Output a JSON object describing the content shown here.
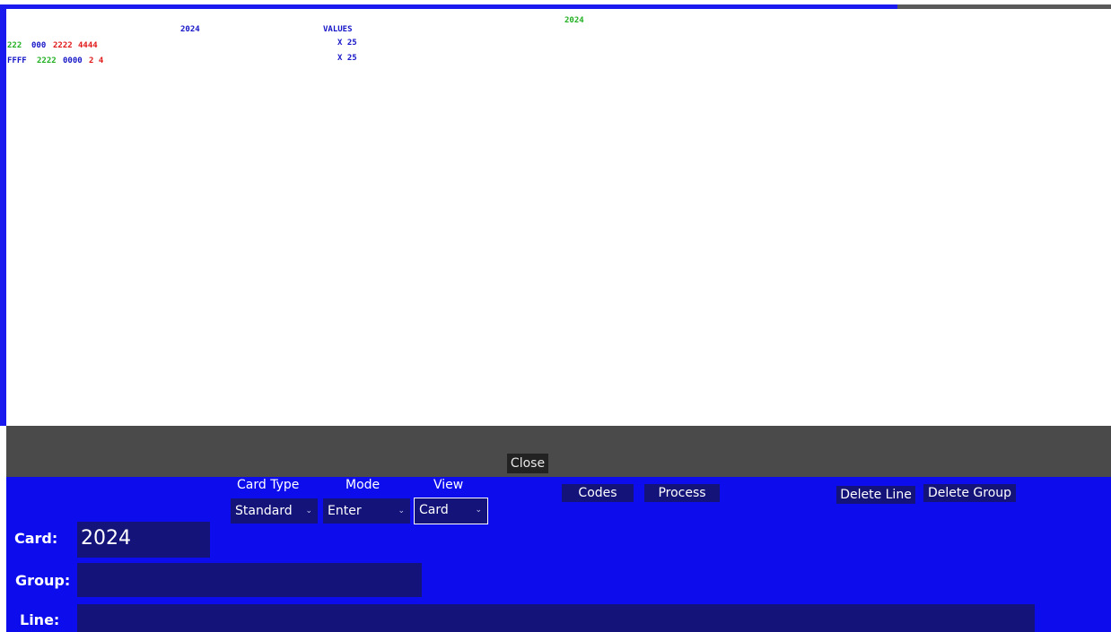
{
  "output": {
    "header_year": "2024",
    "header_values": "VALUES",
    "header_year_right": "2024",
    "row1": {
      "a": "222",
      "b": "000",
      "c": "2222",
      "d": "4444",
      "mult": "X 25"
    },
    "row2": {
      "a": "FFFF",
      "b": "2222",
      "c": "0000",
      "d": "2 4",
      "mult": "X 25"
    }
  },
  "close_label": "Close",
  "controls": {
    "card_type_label": "Card Type",
    "card_type_value": "Standard",
    "mode_label": "Mode",
    "mode_value": "Enter",
    "view_label": "View",
    "view_value": "Card",
    "codes_label": "Codes",
    "process_label": "Process",
    "delete_line_label": "Delete Line",
    "delete_group_label": "Delete Group"
  },
  "fields": {
    "card_label": "Card:",
    "card_value": "2024",
    "group_label": "Group:",
    "group_value": "",
    "line_label": "Line:",
    "line_value": ""
  },
  "colors": {
    "panel_blue": "#0c0ced",
    "input_navy": "#13137a",
    "text_blue": "#1616c8",
    "text_green": "#22b022",
    "text_red": "#e01818"
  }
}
